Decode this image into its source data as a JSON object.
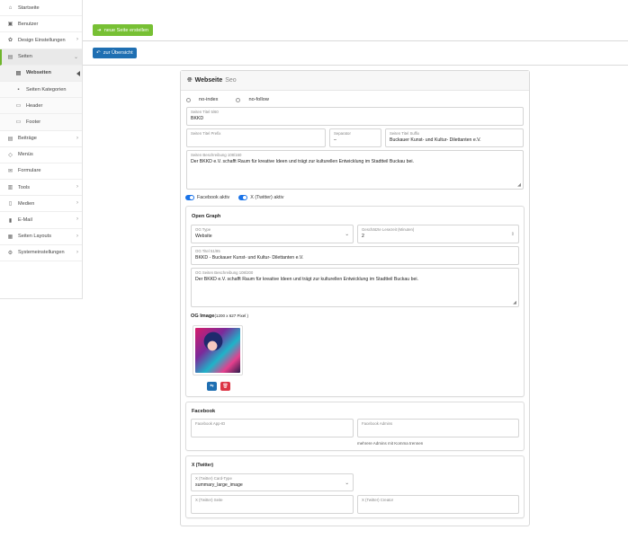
{
  "sidebar": {
    "items": [
      {
        "label": "Startseite",
        "icon": "home-icon",
        "glyph": "⌂"
      },
      {
        "label": "Benutzer",
        "icon": "user-icon",
        "glyph": "▣"
      },
      {
        "label": "Design Einstellungen",
        "icon": "palette-icon",
        "glyph": "✿"
      },
      {
        "label": "Seiten",
        "icon": "pages-icon",
        "glyph": "▤"
      },
      {
        "label": "Webseiten",
        "icon": "list-icon",
        "glyph": "▤"
      },
      {
        "label": "Seiten Kategorien",
        "icon": "bookmark-icon",
        "glyph": "▪"
      },
      {
        "label": "Header",
        "icon": "header-icon",
        "glyph": "▭"
      },
      {
        "label": "Footer",
        "icon": "footer-icon",
        "glyph": "▭"
      },
      {
        "label": "Beiträge",
        "icon": "posts-icon",
        "glyph": "▤"
      },
      {
        "label": "Menüs",
        "icon": "menu-icon",
        "glyph": "◇"
      },
      {
        "label": "Formulare",
        "icon": "form-icon",
        "glyph": "✉"
      },
      {
        "label": "Tools",
        "icon": "tools-icon",
        "glyph": "▥"
      },
      {
        "label": "Medien",
        "icon": "media-icon",
        "glyph": "▯"
      },
      {
        "label": "E-Mail",
        "icon": "mail-icon",
        "glyph": "▮"
      },
      {
        "label": "Seiten Layouts",
        "icon": "layout-icon",
        "glyph": "▦"
      },
      {
        "label": "Systemeinstellungen",
        "icon": "settings-icon",
        "glyph": "⚙"
      }
    ]
  },
  "toolbar": {
    "new_page": "neue Seite erstellen",
    "overview": "zur Übersicht"
  },
  "card": {
    "title": "Webseite",
    "title_suffix": "Seo",
    "noindex": "no-index",
    "nofollow": "no-follow",
    "page_title": {
      "label": "Seiten Titel 5/60",
      "value": "BKKD"
    },
    "title_prefix": {
      "label": "Seiten Titel Prefix",
      "value": ""
    },
    "separator": {
      "label": "Separator",
      "value": "–"
    },
    "title_suffix_field": {
      "label": "Seiten Titel Suffix",
      "value": "Buckauer Kunst- und Kultur- Dilettanten e.V."
    },
    "description": {
      "label": "Seiten Beschreibung 108/160",
      "value": "Der BKKD e.V. schafft Raum für kreative Ideen und trägt zur kulturellen Entwicklung im Stadtteil Buckau bei."
    },
    "facebook_toggle": "Facebook aktiv",
    "twitter_toggle": "X (Twitter) aktiv"
  },
  "open_graph": {
    "title": "Open Graph",
    "og_type": {
      "label": "OG Type",
      "value": "Website"
    },
    "read_time": {
      "label": "Geschätzte Lesezeit (Minuten)",
      "value": "2"
    },
    "og_title": {
      "label": "OG Titel 51/95",
      "value": "BKKD - Buckauer Kunst- und Kultur- Dilettanten e.V."
    },
    "og_description": {
      "label": "OG Seiten Beschreibung 108/200",
      "value": "Der BKKD e.V. schafft Raum für kreative Ideen und trägt zur kulturellen Entwicklung im Stadtteil Buckau bei."
    },
    "og_image_label": "OG Image",
    "og_image_size": "(1200 x 627 Pixel )"
  },
  "facebook": {
    "title": "Facebook",
    "app_id": {
      "label": "Facebook App-ID",
      "value": ""
    },
    "admins": {
      "label": "Facebook Admins",
      "value": ""
    },
    "admins_note": "mehrere Admins mit Komma trennen"
  },
  "twitter": {
    "title": "X (Twitter)",
    "card_type": {
      "label": "X (Twitter) Card-Type",
      "value": "summary_large_image"
    },
    "site": {
      "label": "X (Twitter) Seite",
      "value": ""
    },
    "creator": {
      "label": "X (Twitter) Creator",
      "value": ""
    }
  },
  "colors": {
    "green": "#77c034",
    "blue": "#1f6fb2",
    "toggle": "#1a73e8",
    "danger": "#dc3545"
  }
}
